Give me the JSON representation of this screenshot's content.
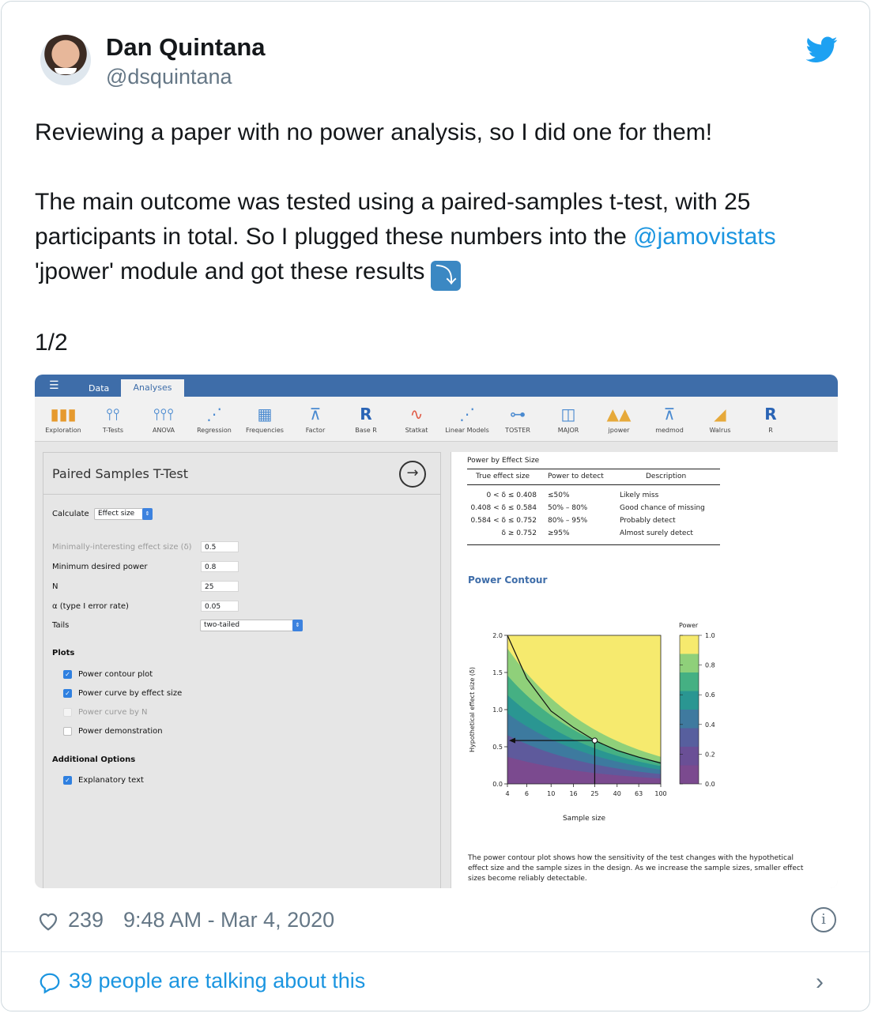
{
  "tweet": {
    "name": "Dan Quintana",
    "handle": "@dsquintana",
    "text_line1": "Reviewing a paper with no power analysis, so I did one for them!",
    "text_line2a": "The main outcome was tested using a paired-samples t-test, with 25 participants in total. So I plugged these numbers into the ",
    "mention": "@jamovistats",
    "text_line2b": " 'jpower' module and got these results",
    "arrow_emoji": "⤵",
    "thread_index": "1/2",
    "likes": "239",
    "timestamp": "9:48 AM - Mar 4, 2020",
    "talking": "39 people are talking about this"
  },
  "jamovi": {
    "tabs": {
      "data": "Data",
      "analyses": "Analyses"
    },
    "ribbon": [
      {
        "label": "Exploration",
        "icon": "bar-chart-icon"
      },
      {
        "label": "T-Tests",
        "icon": "ttest-icon"
      },
      {
        "label": "ANOVA",
        "icon": "anova-icon"
      },
      {
        "label": "Regression",
        "icon": "regression-icon"
      },
      {
        "label": "Frequencies",
        "icon": "frequencies-icon"
      },
      {
        "label": "Factor",
        "icon": "factor-icon"
      },
      {
        "label": "Base R",
        "icon": "r-icon"
      },
      {
        "label": "Statkat",
        "icon": "statkat-icon"
      },
      {
        "label": "Linear Models",
        "icon": "linear-models-icon"
      },
      {
        "label": "TOSTER",
        "icon": "toster-icon"
      },
      {
        "label": "MAJOR",
        "icon": "major-icon"
      },
      {
        "label": "jpower",
        "icon": "jpower-icon"
      },
      {
        "label": "medmod",
        "icon": "medmod-icon"
      },
      {
        "label": "Walrus",
        "icon": "walrus-icon"
      },
      {
        "label": "R",
        "icon": "r-icon"
      }
    ],
    "options": {
      "title": "Paired Samples T-Test",
      "calculate_label": "Calculate",
      "calculate_value": "Effect size",
      "min_effect_label": "Minimally-interesting effect size (δ)",
      "min_effect_value": "0.5",
      "min_power_label": "Minimum desired power",
      "min_power_value": "0.8",
      "n_label": "N",
      "n_value": "25",
      "alpha_label": "α (type I error rate)",
      "alpha_value": "0.05",
      "tails_label": "Tails",
      "tails_value": "two-tailed",
      "plots_heading": "Plots",
      "plots": [
        {
          "label": "Power contour plot",
          "checked": true,
          "disabled": false
        },
        {
          "label": "Power curve by effect size",
          "checked": true,
          "disabled": false
        },
        {
          "label": "Power curve by N",
          "checked": false,
          "disabled": true
        },
        {
          "label": "Power demonstration",
          "checked": false,
          "disabled": false
        }
      ],
      "additional_heading": "Additional Options",
      "explanatory_text_label": "Explanatory text"
    },
    "results": {
      "table_title": "Power by Effect Size",
      "headers": [
        "True effect size",
        "Power to detect",
        "Description"
      ],
      "rows": [
        [
          "0 < δ ≤ 0.408",
          "≤50%",
          "Likely miss"
        ],
        [
          "0.408 < δ ≤ 0.584",
          "50% – 80%",
          "Good chance of missing"
        ],
        [
          "0.584 < δ ≤ 0.752",
          "80% – 95%",
          "Probably detect"
        ],
        [
          "δ ≥ 0.752",
          "≥95%",
          "Almost surely detect"
        ]
      ],
      "contour_title": "Power Contour",
      "caption": "The power contour plot shows how the sensitivity of the test changes with the hypothetical effect size and the sample sizes in the design. As we increase the sample sizes, smaller effect sizes become reliably detectable."
    }
  },
  "chart_data": {
    "type": "heatmap",
    "title": "",
    "xlabel": "Sample size",
    "ylabel": "Hypothetical effect size (δ)",
    "x_scale": "log",
    "x_ticks": [
      4,
      6,
      10,
      16,
      25,
      40,
      63,
      100
    ],
    "y_ticks": [
      0.0,
      0.5,
      1.0,
      1.5,
      2.0
    ],
    "xlim": [
      4,
      100
    ],
    "ylim": [
      0,
      2
    ],
    "z": "power",
    "legend_title": "Power",
    "legend_ticks": [
      0.0,
      0.2,
      0.4,
      0.6,
      0.8,
      1.0
    ],
    "colors": [
      "#7b4a8f",
      "#5e5a9c",
      "#3d7a9f",
      "#2a9692",
      "#45b083",
      "#8fd07a",
      "#f6ea6e"
    ],
    "power_curve_08": [
      [
        4,
        2.0
      ],
      [
        6,
        1.42
      ],
      [
        10,
        0.98
      ],
      [
        16,
        0.76
      ],
      [
        25,
        0.584
      ],
      [
        40,
        0.45
      ],
      [
        63,
        0.36
      ],
      [
        100,
        0.28
      ]
    ],
    "design_point": {
      "n": 25,
      "delta": 0.584
    }
  }
}
